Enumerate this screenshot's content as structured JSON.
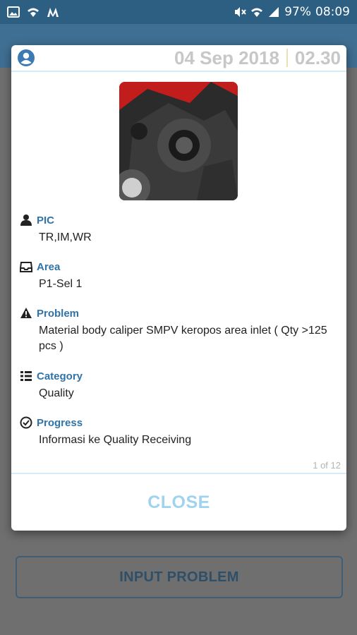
{
  "status_bar": {
    "battery": "97%",
    "time": "08:09",
    "icons": [
      "image-icon",
      "wifi-icon",
      "app-icon",
      "mute-icon",
      "wifi-icon",
      "signal-icon"
    ]
  },
  "background": {
    "input_button_label": "INPUT PROBLEM"
  },
  "dialog": {
    "date": "04 Sep 2018",
    "time": "02.30",
    "fields": [
      {
        "icon": "person-icon",
        "label": "PIC",
        "value": "TR,IM,WR"
      },
      {
        "icon": "inbox-icon",
        "label": "Area",
        "value": "P1-Sel 1"
      },
      {
        "icon": "warning-icon",
        "label": "Problem",
        "value": "Material body caliper SMPV keropos area inlet ( Qty >125 pcs )"
      },
      {
        "icon": "list-icon",
        "label": "Category",
        "value": "Quality"
      },
      {
        "icon": "check-circle-icon",
        "label": "Progress",
        "value": "Informasi ke Quality Receiving"
      }
    ],
    "pager": "1 of 12",
    "close_label": "CLOSE"
  },
  "colors": {
    "status_bar": "#2d5f83",
    "label_blue": "#2f73a8",
    "close_text": "#9fd3ef"
  }
}
